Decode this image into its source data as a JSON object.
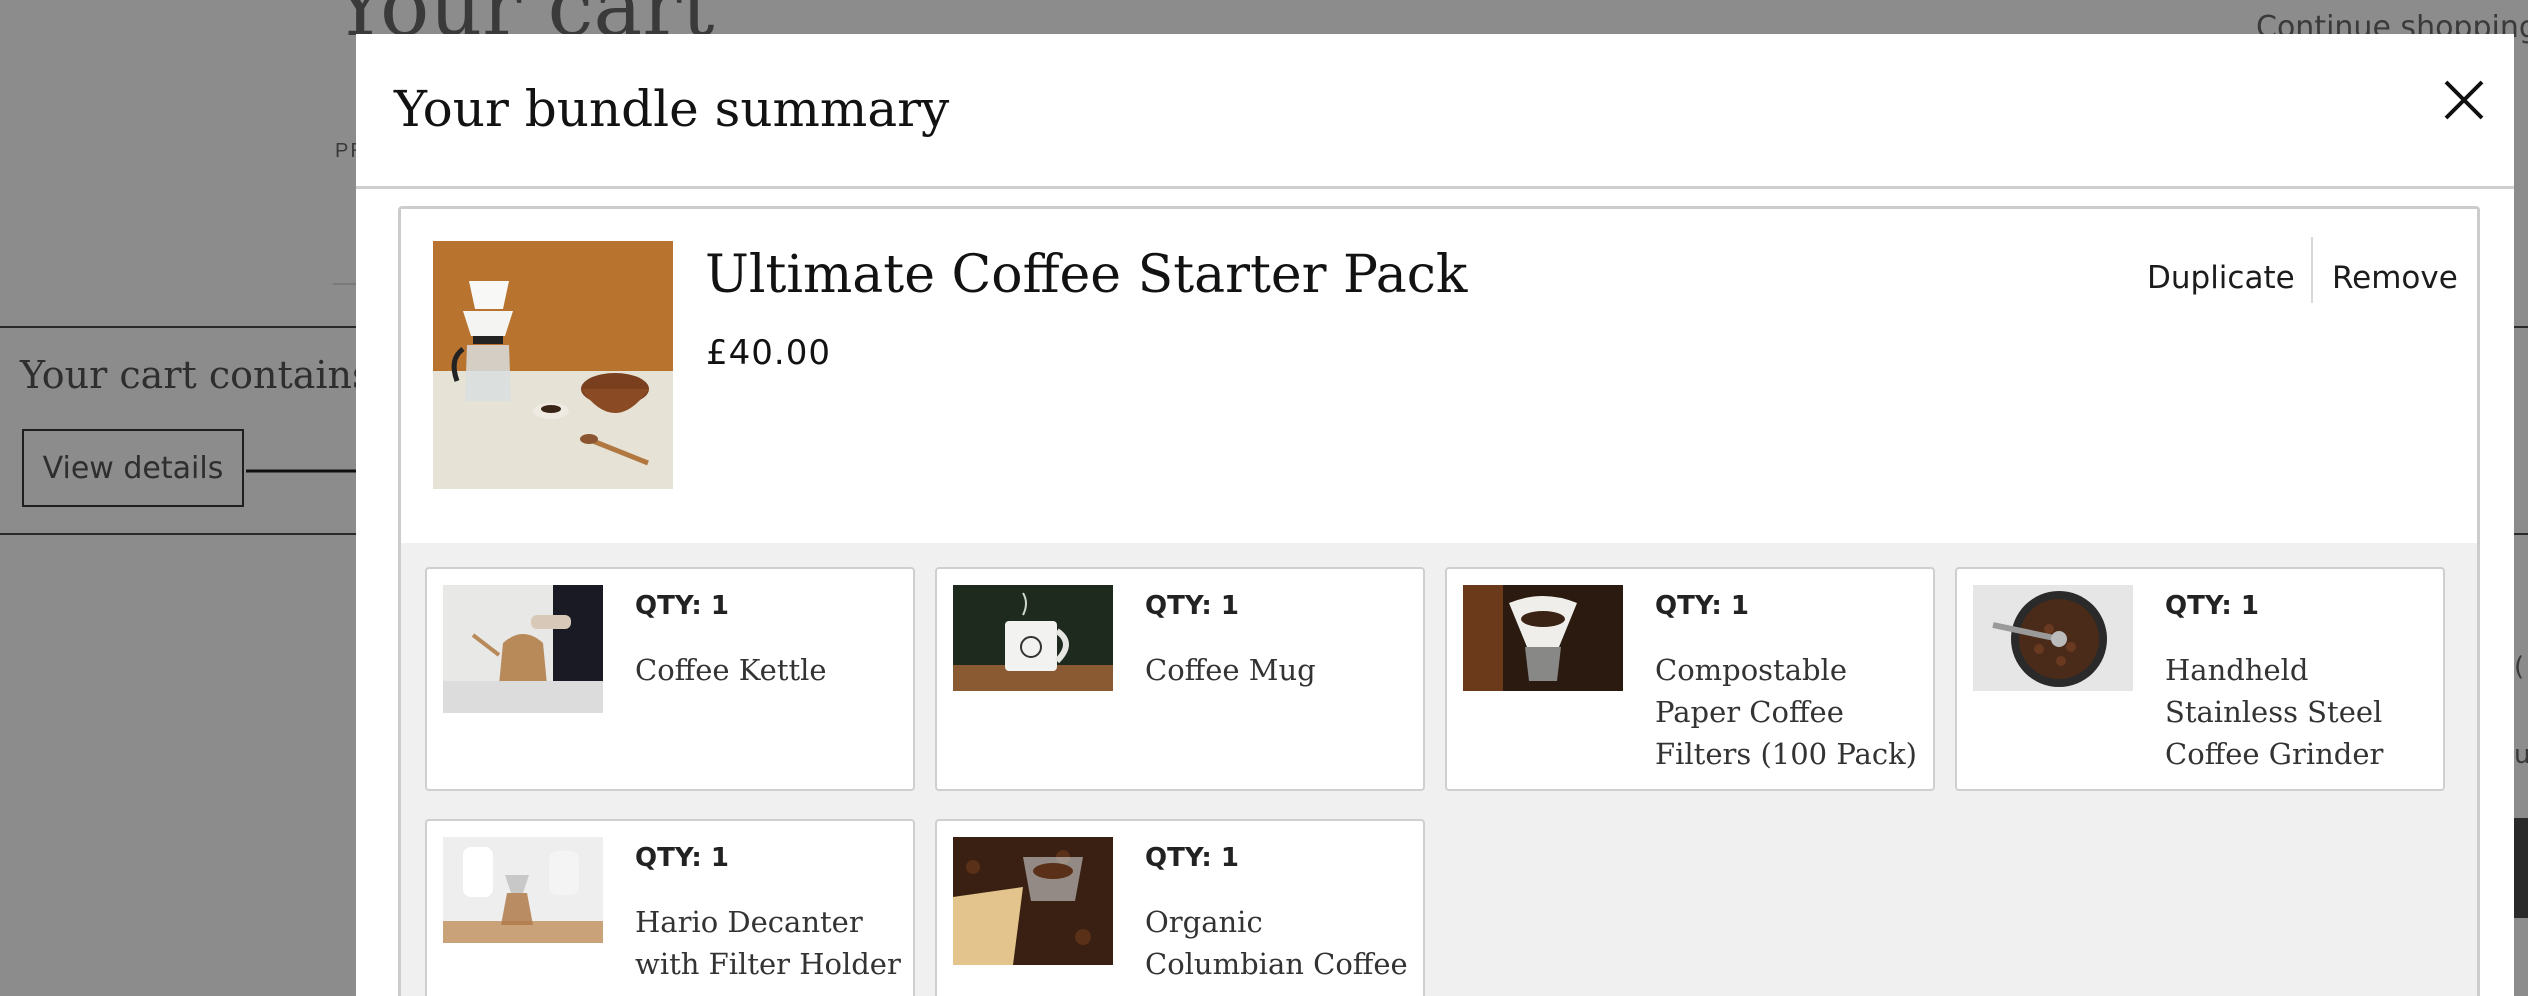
{
  "background_page": {
    "title": "Your cart",
    "continue_link": "Continue shopping",
    "column_fragment": "PR",
    "cart_contains_text": "Your cart contains",
    "view_details_button": "View details",
    "right_fragment_1": "(",
    "right_fragment_2": "u"
  },
  "modal": {
    "title": "Your bundle summary",
    "close_icon": "close-icon",
    "bundle": {
      "name": "Ultimate Coffee Starter Pack",
      "price": "£40.00",
      "duplicate_label": "Duplicate",
      "remove_label": "Remove",
      "items": [
        {
          "qty": "QTY: 1",
          "name": "Coffee Kettle"
        },
        {
          "qty": "QTY: 1",
          "name": "Coffee Mug"
        },
        {
          "qty": "QTY: 1",
          "name": "Compostable Paper Coffee Filters (100 Pack)"
        },
        {
          "qty": "QTY: 1",
          "name": "Handheld Stainless Steel Coffee Grinder"
        },
        {
          "qty": "QTY: 1",
          "name": "Hario Decanter with Filter Holder"
        },
        {
          "qty": "QTY: 1",
          "name": "Organic Columbian Coffee"
        }
      ]
    }
  },
  "colors": {
    "overlay": "#8c8c8c",
    "modal_bg": "#ffffff",
    "items_bg": "#f0f0f0",
    "border": "#cccccc",
    "text": "#121212"
  }
}
